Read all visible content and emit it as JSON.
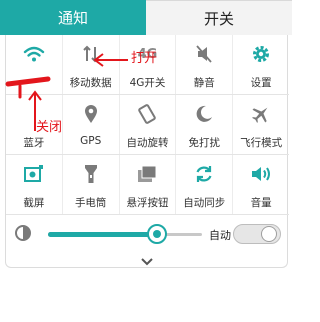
{
  "tabs": {
    "notification": "通知",
    "switches": "开关"
  },
  "toggles": [
    {
      "label": "",
      "icon": "wifi-icon"
    },
    {
      "label": "移动数据",
      "icon": "mobile-data-icon"
    },
    {
      "label": "4G开关",
      "icon": "4g-icon",
      "icon_text": "4G"
    },
    {
      "label": "静音",
      "icon": "mute-icon"
    },
    {
      "label": "设置",
      "icon": "gear-icon"
    },
    {
      "label": "蓝牙",
      "icon": "bluetooth-icon"
    },
    {
      "label": "GPS",
      "icon": "location-pin-icon"
    },
    {
      "label": "自动旋转",
      "icon": "rotate-icon"
    },
    {
      "label": "免打扰",
      "icon": "moon-icon"
    },
    {
      "label": "飞行模式",
      "icon": "airplane-icon"
    },
    {
      "label": "截屏",
      "icon": "screenshot-icon"
    },
    {
      "label": "手电筒",
      "icon": "flashlight-icon"
    },
    {
      "label": "悬浮按钮",
      "icon": "floating-button-icon"
    },
    {
      "label": "自动同步",
      "icon": "sync-icon"
    },
    {
      "label": "音量",
      "icon": "volume-icon"
    }
  ],
  "brightness": {
    "auto_label": "自动",
    "level": 0.8,
    "auto_enabled": false
  },
  "annotations": {
    "open": "打开",
    "close": "关闭"
  },
  "colors": {
    "accent": "#1ea9a6",
    "annotation_red": "#e3161c"
  }
}
